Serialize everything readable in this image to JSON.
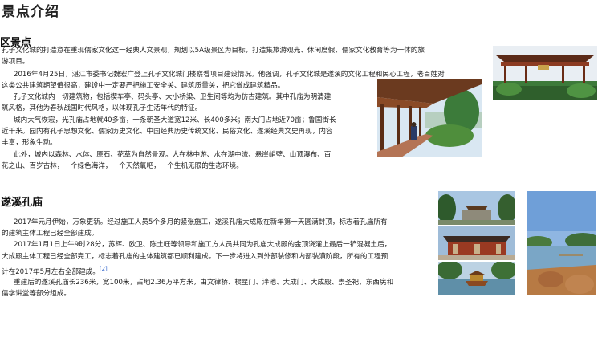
{
  "page_title": "景点介绍",
  "section1": {
    "heading": "区景点",
    "lines": [
      "孔子文化城的打造意在重现儒家文化这一经典人文景观，规划以5A级景区为目标，打造集旅游观光、休闲度假、儒家文化教育等为一体的旅",
      "游项目。",
      "2016年4月25日，湛江市委书记魏宏广登上孔子文化城门楼察看项目建设情况。他强调，孔子文化城是遂溪的文化工程和民心工程，老百姓对",
      "这类公共建筑期望值很高，建设中一定要严把施工安全关、建筑质量关，把它做成建筑精品。",
      "孔子文化城内一切建筑物，包括楔车亭、码头亭、大小桥梁、卫生间等均为仿古建筑。其中孔庙为明清建",
      "筑风格，其他为春秋战国时代风格，以体现孔子生活年代的特征。",
      "城内大气恢宏，光孔庙占地就40多亩，一条朝圣大道宽12米、长400多米；南大门占地近70亩；鲁国街长",
      "近千米。园内有孔子思想文化、儒家历史文化、中国经典历史传统文化、民俗文化、遂溪经典文史再现，内容",
      "丰富，形象生动。",
      "此外，城内以森林、水体、原石、花草为自然景观。人在林中游、水在湖中流、悬崖峭壁、山顶瀑布、百",
      "花之山、百岁古林，一个绿色海洋，一个天然氧吧，一个生机无限的生态环境。"
    ]
  },
  "section2": {
    "heading": "遂溪孔庙",
    "lines": [
      "2017年元月伊始，万象更新。经过施工人员5个多月的紧张施工，遂溪孔庙大成殿在新年第一天圆满封顶，标志着孔庙所有",
      "的建筑主体工程已经全部建成。",
      "2017年1月1日上午9时28分，苏辉、欧卫、陈土旺等领导和施工方人员共同为孔庙大成殿的金顶浇灌上最后一铲混凝土后，",
      "大成殿主体工程已经全部完工，标志着孔庙的主体建筑都已顺利建成。下一步将进入到外部装修和内部装潢阶段，所有的工程预",
      "计在2017年5月左右全部建成。",
      "重建后的遂溪孔庙长236米，宽100米，占地2.36万平方米，由文律桥、棂星门、泮池、大成门、大成殿、崇圣祀、东西庑和",
      "儒学讲堂等部分组成。"
    ],
    "ref": "[2]"
  },
  "images": {
    "pavilion": "pavilion-photo",
    "corridor": "corridor-photo",
    "gate": "city-gate-photo",
    "hall": "temple-hall-photo",
    "boat": "boat-photo",
    "lake": "lake-photo"
  }
}
